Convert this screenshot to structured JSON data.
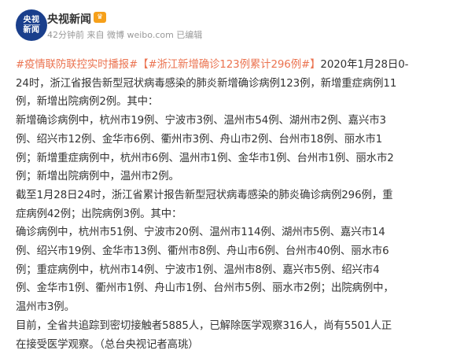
{
  "header": {
    "avatar_text_top": "央视",
    "avatar_text_bottom": "新闻",
    "nickname": "央视新闻",
    "vip_badge": "♛",
    "meta": "42分钟前 来自 微博 weibo.com 已编辑"
  },
  "post": {
    "topic_1": "#疫情联防联控实时播报#",
    "topic_2": "【#浙江新增确诊123例累计296例#】",
    "lines": [
      "2020年1月28日0-",
      "24时，浙江省报告新型冠状病毒感染的肺炎新增确诊病例123例，新增重症病例11",
      "例，新增出院病例2例。其中：",
      "新增确诊病例中，杭州市19例、宁波市3例、温州市54例、湖州市2例、嘉兴市3",
      "例、绍兴市12例、金华市6例、衢州市3例、舟山市2例、台州市18例、丽水市1",
      "例；新增重症病例中，杭州市6例、温州市1例、金华市1例、台州市1例、丽水市2",
      "例；新增出院病例中，温州市2例。",
      "截至1月28日24时，浙江省累计报告新型冠状病毒感染的肺炎确诊病例296例，重",
      "症病例42例；出院病例3例。其中：",
      "确诊病例中，杭州市51例、宁波市20例、温州市114例、湖州市5例、嘉兴市14",
      "例、绍兴市19例、金华市13例、衢州市8例、舟山市6例、台州市40例、丽水市6",
      "例；重症病例中，杭州市14例、宁波市1例、温州市8例、嘉兴市5例、绍兴市4",
      "例、金华市1例、衢州市1例、舟山市1例、台州市5例、丽水市2例；出院病例中，",
      "温州市3例。",
      "目前，全省共追踪到密切接触者5885人，已解除医学观察316人，尚有5501人正",
      "在接受医学观察。（总台央视记者高珧）"
    ]
  },
  "colors": {
    "topic": "#eb7350",
    "text": "#333333",
    "meta": "#999999",
    "avatar_bg": "#1a3f8c"
  }
}
